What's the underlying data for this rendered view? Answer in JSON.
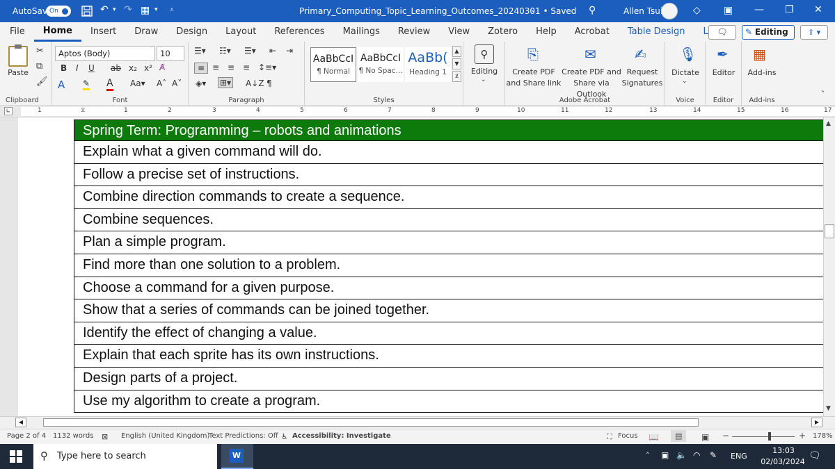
{
  "titlebar": {
    "autosave_label": "AutoSave",
    "autosave_state": "On",
    "document_title": "Primary_Computing_Topic_Learning_Outcomes_20240301 • Saved",
    "user_name": "Allen Tsui",
    "accent_color": "#1b5ebe"
  },
  "menu": {
    "items": [
      "File",
      "Home",
      "Insert",
      "Draw",
      "Design",
      "Layout",
      "References",
      "Mailings",
      "Review",
      "View",
      "Zotero",
      "Help",
      "Acrobat",
      "Table Design",
      "Layout"
    ],
    "active": "Home",
    "editing_label": "Editing"
  },
  "ribbon": {
    "clipboard": {
      "paste": "Paste",
      "label": "Clipboard"
    },
    "font": {
      "name": "Aptos (Body)",
      "size": "10",
      "label": "Font"
    },
    "paragraph": {
      "label": "Paragraph"
    },
    "styles": {
      "label": "Styles",
      "items": [
        {
          "sample": "AaBbCcI",
          "name": "¶ Normal"
        },
        {
          "sample": "AaBbCcI",
          "name": "¶ No Spac..."
        },
        {
          "sample": "AaBb(",
          "name": "Heading 1"
        }
      ]
    },
    "editing": {
      "label": "Editing"
    },
    "acrobat": {
      "label": "Adobe Acrobat",
      "create_pdf": [
        "Create PDF",
        "and Share link"
      ],
      "create_pdf_outlook": [
        "Create PDF and",
        "Share via Outlook"
      ],
      "request_signatures": [
        "Request",
        "Signatures"
      ]
    },
    "voice": {
      "dictate": "Dictate",
      "label": "Voice"
    },
    "editor": {
      "editor": "Editor",
      "label": "Editor"
    },
    "addins": {
      "addins": "Add-ins",
      "label": "Add-ins"
    }
  },
  "ruler": {
    "numbers": [
      "1",
      "1",
      "2",
      "3",
      "4",
      "5",
      "6",
      "7",
      "8",
      "9",
      "10",
      "11",
      "12",
      "13",
      "14",
      "15",
      "16",
      "17"
    ]
  },
  "table": {
    "header": "Spring Term: Programming – robots and animations",
    "header_color": "#0c7b0c",
    "rows": [
      "Explain what a given command will do.",
      "Follow a precise set of instructions.",
      "Combine direction commands to create a sequence.",
      "Combine sequences.",
      "Plan a simple program.",
      "Find more than one solution to a problem.",
      "Choose a command for a given purpose.",
      "Show that a series of commands can be joined together.",
      "Identify the effect of changing a value.",
      "Explain that each sprite has its own instructions.",
      "Design parts of a project.",
      "Use my algorithm to create a program."
    ]
  },
  "status": {
    "page": "Page 2 of 4",
    "words": "1132 words",
    "language": "English (United Kingdom)",
    "predictions": "Text Predictions: Off",
    "accessibility": "Accessibility: Investigate",
    "focus": "Focus",
    "zoom": "178%"
  },
  "taskbar": {
    "search_placeholder": "Type here to search",
    "language": "ENG",
    "time": "13:03",
    "date": "02/03/2024"
  }
}
